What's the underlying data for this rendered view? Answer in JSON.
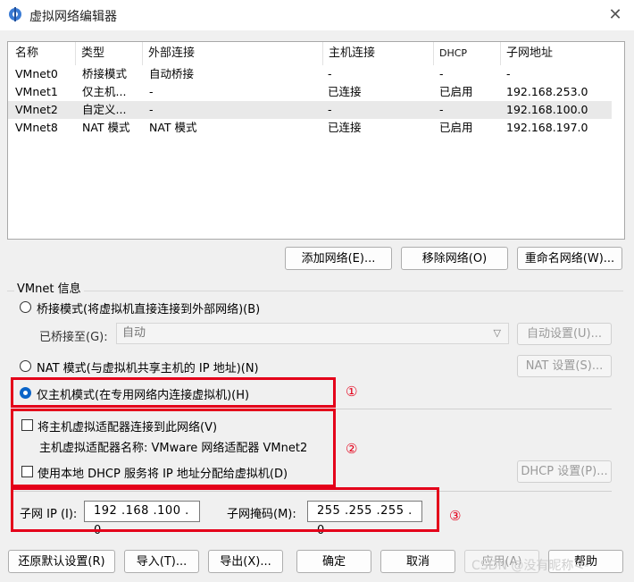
{
  "window": {
    "title": "虚拟网络编辑器",
    "close_icon": "close-icon"
  },
  "table": {
    "headers": [
      "名称",
      "类型",
      "外部连接",
      "主机连接",
      "DHCP",
      "子网地址"
    ],
    "rows": [
      [
        "VMnet0",
        "桥接模式",
        "自动桥接",
        "-",
        "-",
        "-"
      ],
      [
        "VMnet1",
        "仅主机...",
        "-",
        "已连接",
        "已启用",
        "192.168.253.0"
      ],
      [
        "VMnet2",
        "自定义...",
        "-",
        "-",
        "-",
        "192.168.100.0"
      ],
      [
        "VMnet8",
        "NAT 模式",
        "NAT 模式",
        "已连接",
        "已启用",
        "192.168.197.0"
      ]
    ],
    "selected_row": "VMnet2"
  },
  "net_buttons": {
    "add": "添加网络(E)...",
    "remove": "移除网络(O)",
    "rename": "重命名网络(W)..."
  },
  "vmnet_info": {
    "group_label": "VMnet 信息",
    "bridged_label": "桥接模式(将虚拟机直接连接到外部网络)(B)",
    "bridged_to_label": "已桥接至(G):",
    "bridged_to_value": "自动",
    "auto_settings": "自动设置(U)...",
    "nat_label": "NAT 模式(与虚拟机共享主机的 IP 地址)(N)",
    "nat_settings": "NAT 设置(S)...",
    "hostonly_label": "仅主机模式(在专用网络内连接虚拟机)(H)",
    "connect_adapter_label": "将主机虚拟适配器连接到此网络(V)",
    "adapter_name_text": "主机虚拟适配器名称: VMware 网络适配器 VMnet2",
    "dhcp_label": "使用本地 DHCP 服务将 IP 地址分配给虚拟机(D)",
    "dhcp_settings": "DHCP 设置(P)...",
    "selected_mode": "host-only",
    "subnet_ip_label": "子网 IP (I):",
    "subnet_ip_value": "192 .168 .100 .  0",
    "subnet_mask_label": "子网掩码(M):",
    "subnet_mask_value": "255 .255 .255 .  0"
  },
  "annotations": {
    "one": "①",
    "two": "②",
    "three": "③",
    "color": "#e4001a"
  },
  "footer": {
    "restore": "还原默认设置(R)",
    "import": "导入(T)...",
    "export": "导出(X)...",
    "ok": "确定",
    "cancel": "取消",
    "apply": "应用(A)",
    "help": "帮助"
  },
  "watermark": "CSDN @没有昵称<-"
}
